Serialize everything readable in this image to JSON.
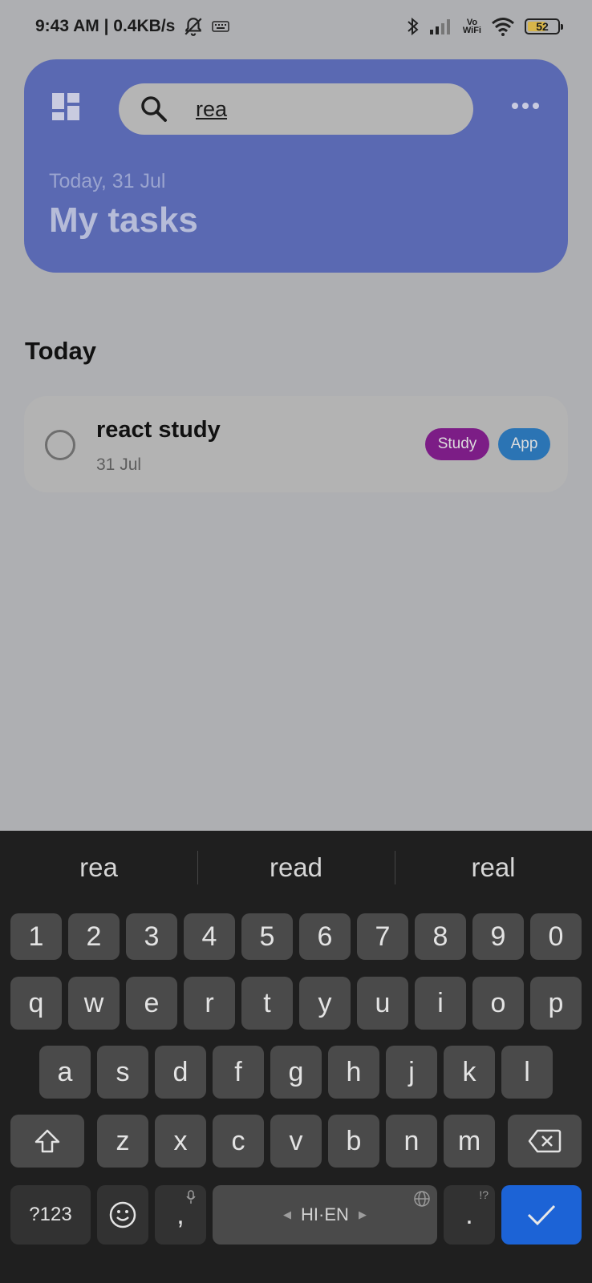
{
  "status_bar": {
    "time_speed": "9:43 AM | 0.4KB/s",
    "vo_wifi_top": "Vo",
    "vo_wifi_bottom": "WiFi",
    "battery": "52"
  },
  "header": {
    "search_value": "rea",
    "date_label": "Today, 31 Jul",
    "title": "My tasks",
    "colors": {
      "card": "#5a69b2"
    }
  },
  "section": {
    "title": "Today"
  },
  "task": {
    "title": "react study",
    "date": "31 Jul",
    "tags": [
      {
        "label": "Study",
        "color": "#7c1d86"
      },
      {
        "label": "App",
        "color": "#2b74b4"
      }
    ]
  },
  "keyboard": {
    "suggestions": [
      "rea",
      "read",
      "real"
    ],
    "numbers": [
      "1",
      "2",
      "3",
      "4",
      "5",
      "6",
      "7",
      "8",
      "9",
      "0"
    ],
    "row1": [
      "q",
      "w",
      "e",
      "r",
      "t",
      "y",
      "u",
      "i",
      "o",
      "p"
    ],
    "row2": [
      "a",
      "s",
      "d",
      "f",
      "g",
      "h",
      "j",
      "k",
      "l"
    ],
    "row3": [
      "z",
      "x",
      "c",
      "v",
      "b",
      "n",
      "m"
    ],
    "symbols_key": "?123",
    "comma": ",",
    "space_label": "HI·EN",
    "period": ".",
    "period_hint": "!?"
  }
}
